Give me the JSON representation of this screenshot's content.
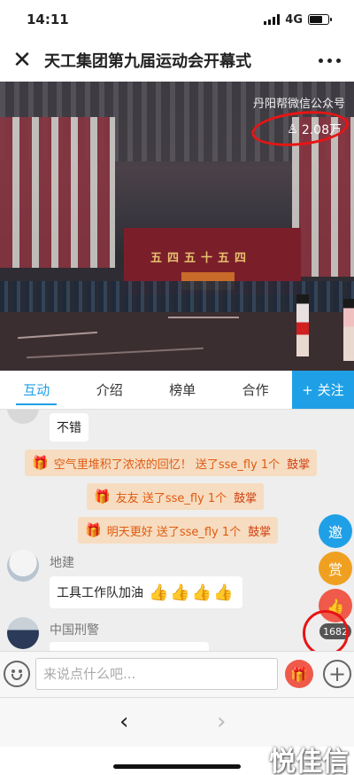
{
  "status": {
    "time": "14:11",
    "network": "4G"
  },
  "header": {
    "title": "天工集团第九届运动会开幕式"
  },
  "video": {
    "watermark": "丹阳帮微信公众号",
    "viewers": "2.08万",
    "stage_sign": "五四五十五四"
  },
  "tabs": [
    {
      "label": "互动"
    },
    {
      "label": "介绍"
    },
    {
      "label": "榜单"
    },
    {
      "label": "合作"
    },
    {
      "label": "+ 关注"
    }
  ],
  "chat": {
    "msg1": "不错",
    "gifts": [
      {
        "text": "空气里堆积了浓浓的回忆！ 送了sse_fly 1个",
        "action": "鼓掌"
      },
      {
        "text": "友友 送了sse_fly 1个",
        "action": "鼓掌"
      },
      {
        "text": "明天更好 送了sse_fly 1个",
        "action": "鼓掌"
      }
    ],
    "user1": {
      "name": "地建",
      "message": "工具工作队加油",
      "thumbs": "👍👍👍👍"
    },
    "user2": {
      "name": "中国刑警"
    }
  },
  "side_buttons": {
    "share": "邀",
    "reward": "赏",
    "like_count": "1682"
  },
  "input": {
    "placeholder": "来说点什么吧..."
  },
  "nav": {
    "back": "‹",
    "forward": "›"
  },
  "site_watermark": "悦佳信"
}
